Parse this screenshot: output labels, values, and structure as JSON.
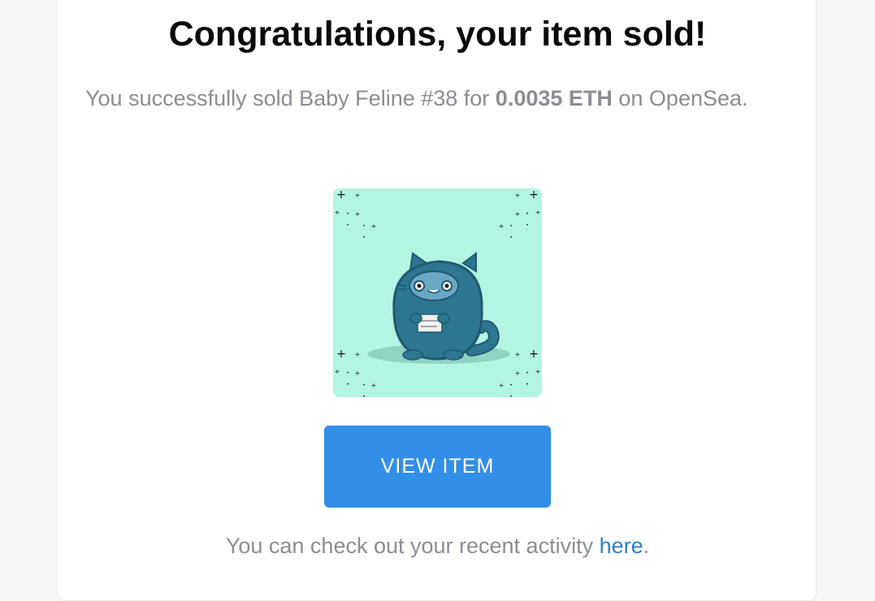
{
  "email": {
    "title": "Congratulations, your item sold!",
    "message_prefix": "You successfully sold Baby Feline #38 for ",
    "price": "0.0035 ETH",
    "message_suffix": " on OpenSea.",
    "nft_image_icon": "baby-feline-38-image",
    "view_button_label": "VIEW ITEM",
    "footer_prefix": "You can check out your recent activity ",
    "footer_link": "here",
    "footer_suffix": "."
  },
  "colors": {
    "accent_button": "#338ee8",
    "link": "#2f80c7",
    "image_background": "#b3f4e3",
    "cat_body": "#2c7690"
  }
}
